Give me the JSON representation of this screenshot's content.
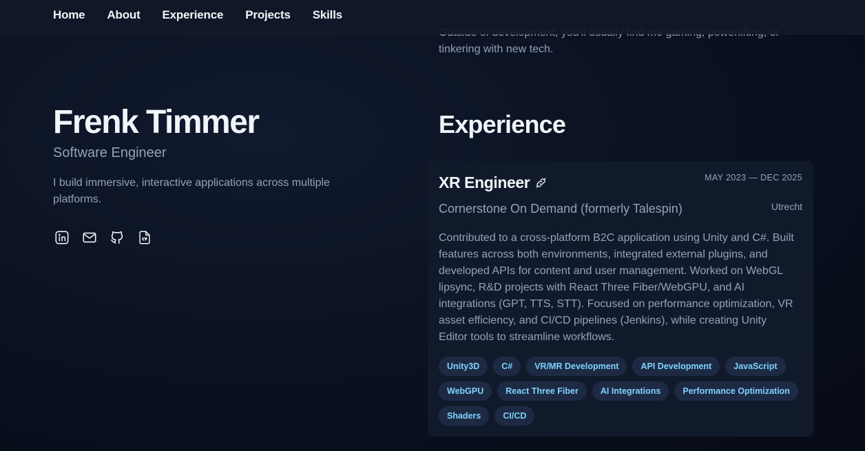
{
  "nav": {
    "items": [
      {
        "label": "Home"
      },
      {
        "label": "About"
      },
      {
        "label": "Experience"
      },
      {
        "label": "Projects"
      },
      {
        "label": "Skills"
      }
    ]
  },
  "about": {
    "tail_text": "Outside of development, you'll usually find me gaming, powerlifting, or tinkering with new tech."
  },
  "profile": {
    "name": "Frenk Timmer",
    "role": "Software Engineer",
    "tagline": "I build immersive, interactive applications across multiple platforms.",
    "socials": [
      {
        "icon": "linkedin-icon"
      },
      {
        "icon": "mail-icon"
      },
      {
        "icon": "github-icon"
      },
      {
        "icon": "cv-icon"
      }
    ]
  },
  "experience": {
    "section_title": "Experience",
    "jobs": [
      {
        "title": "XR Engineer",
        "date": "MAY 2023 — DEC 2025",
        "company": "Cornerstone On Demand (formerly Talespin)",
        "location": "Utrecht",
        "description": "Contributed to a cross-platform B2C application using Unity and C#. Built features across both environments, integrated external plugins, and developed APIs for content and user management. Worked on WebGL lipsync, R&D projects with React Three Fiber/WebGPU, and AI integrations (GPT, TTS, STT). Focused on performance optimization, VR asset efficiency, and CI/CD pipelines (Jenkins), while creating Unity Editor tools to streamline workflows.",
        "tags": [
          "Unity3D",
          "C#",
          "VR/MR Development",
          "API Development",
          "JavaScript",
          "WebGPU",
          "React Three Fiber",
          "AI Integrations",
          "Performance Optimization",
          "Shaders",
          "CI/CD"
        ]
      }
    ]
  },
  "colors": {
    "background": "#0b1120",
    "card": "#111a2b",
    "tag_bg": "#1e2a44",
    "tag_text": "#7dd3fc",
    "muted_text": "#94a3b8",
    "heading_text": "#f1f5f9"
  }
}
